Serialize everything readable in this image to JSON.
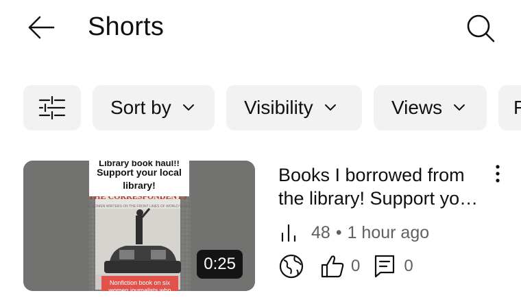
{
  "header": {
    "title": "Shorts",
    "back_icon": "back-arrow-icon",
    "search_icon": "search-icon"
  },
  "filters": {
    "filter_icon": "filter-sliders-icon",
    "chips": [
      {
        "label": "Sort by"
      },
      {
        "label": "Visibility"
      },
      {
        "label": "Views"
      },
      {
        "label": "F"
      }
    ]
  },
  "video": {
    "title": "Books I borrowed from the library! Support your local library!",
    "duration": "0:25",
    "views": "48",
    "separator": "•",
    "time_ago": "1 hour ago",
    "likes": "0",
    "comments": "0",
    "thumbnail": {
      "caption_top": "Library book haul!! Support your local library!",
      "book_title": "THE CORRESPONDENTS",
      "caption_bottom": "Nonfiction book on six women journalists who"
    },
    "visibility_icon": "globe-public-icon",
    "like_icon": "thumbs-up-icon",
    "comment_icon": "comment-icon",
    "more_icon": "more-vertical-icon"
  },
  "colors": {
    "chip_bg": "#f2f2f2",
    "meta_text": "#606060",
    "caption_red": "#e0524a"
  }
}
